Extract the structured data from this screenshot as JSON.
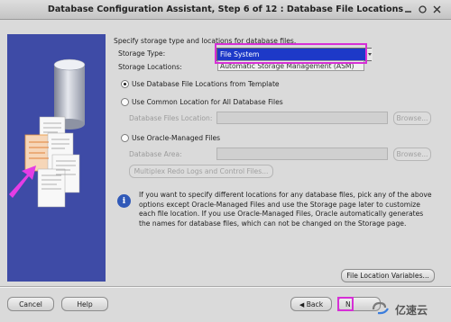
{
  "window": {
    "title": "Database Configuration Assistant, Step 6 of 12 : Database File Locations"
  },
  "main": {
    "intro": "Specify storage type and locations for database files.",
    "storage_type_label": "Storage Type:",
    "storage_type_value": "File System",
    "storage_type_options": [
      "File System",
      "Automatic Storage Management (ASM)"
    ],
    "storage_locations_label": "Storage Locations:",
    "option_template": "Use Database File Locations from Template",
    "option_common": "Use Common Location for All Database Files",
    "files_location_label": "Database Files Location:",
    "files_location_value": "",
    "browse_label": "Browse...",
    "option_omf": "Use Oracle-Managed Files",
    "area_label": "Database Area:",
    "area_value": "",
    "browse2_label": "Browse...",
    "multiplex_label": "Multiplex Redo Logs and Control Files...",
    "info_text": "If you want to specify different locations for any database files, pick any of the above options except Oracle-Managed Files and use the Storage page later to customize each file location. If you use Oracle-Managed Files, Oracle automatically generates the names for database files, which can not be changed on the Storage page.",
    "file_location_vars_label": "File Location Variables..."
  },
  "footer": {
    "cancel_label": "Cancel",
    "help_label": "Help",
    "back_label": "Back",
    "next_label": "N"
  },
  "watermark": {
    "text": "亿速云"
  },
  "colors": {
    "highlight": "#d62fd6",
    "selection": "#1d39c8",
    "banner": "#3e4ba6"
  }
}
